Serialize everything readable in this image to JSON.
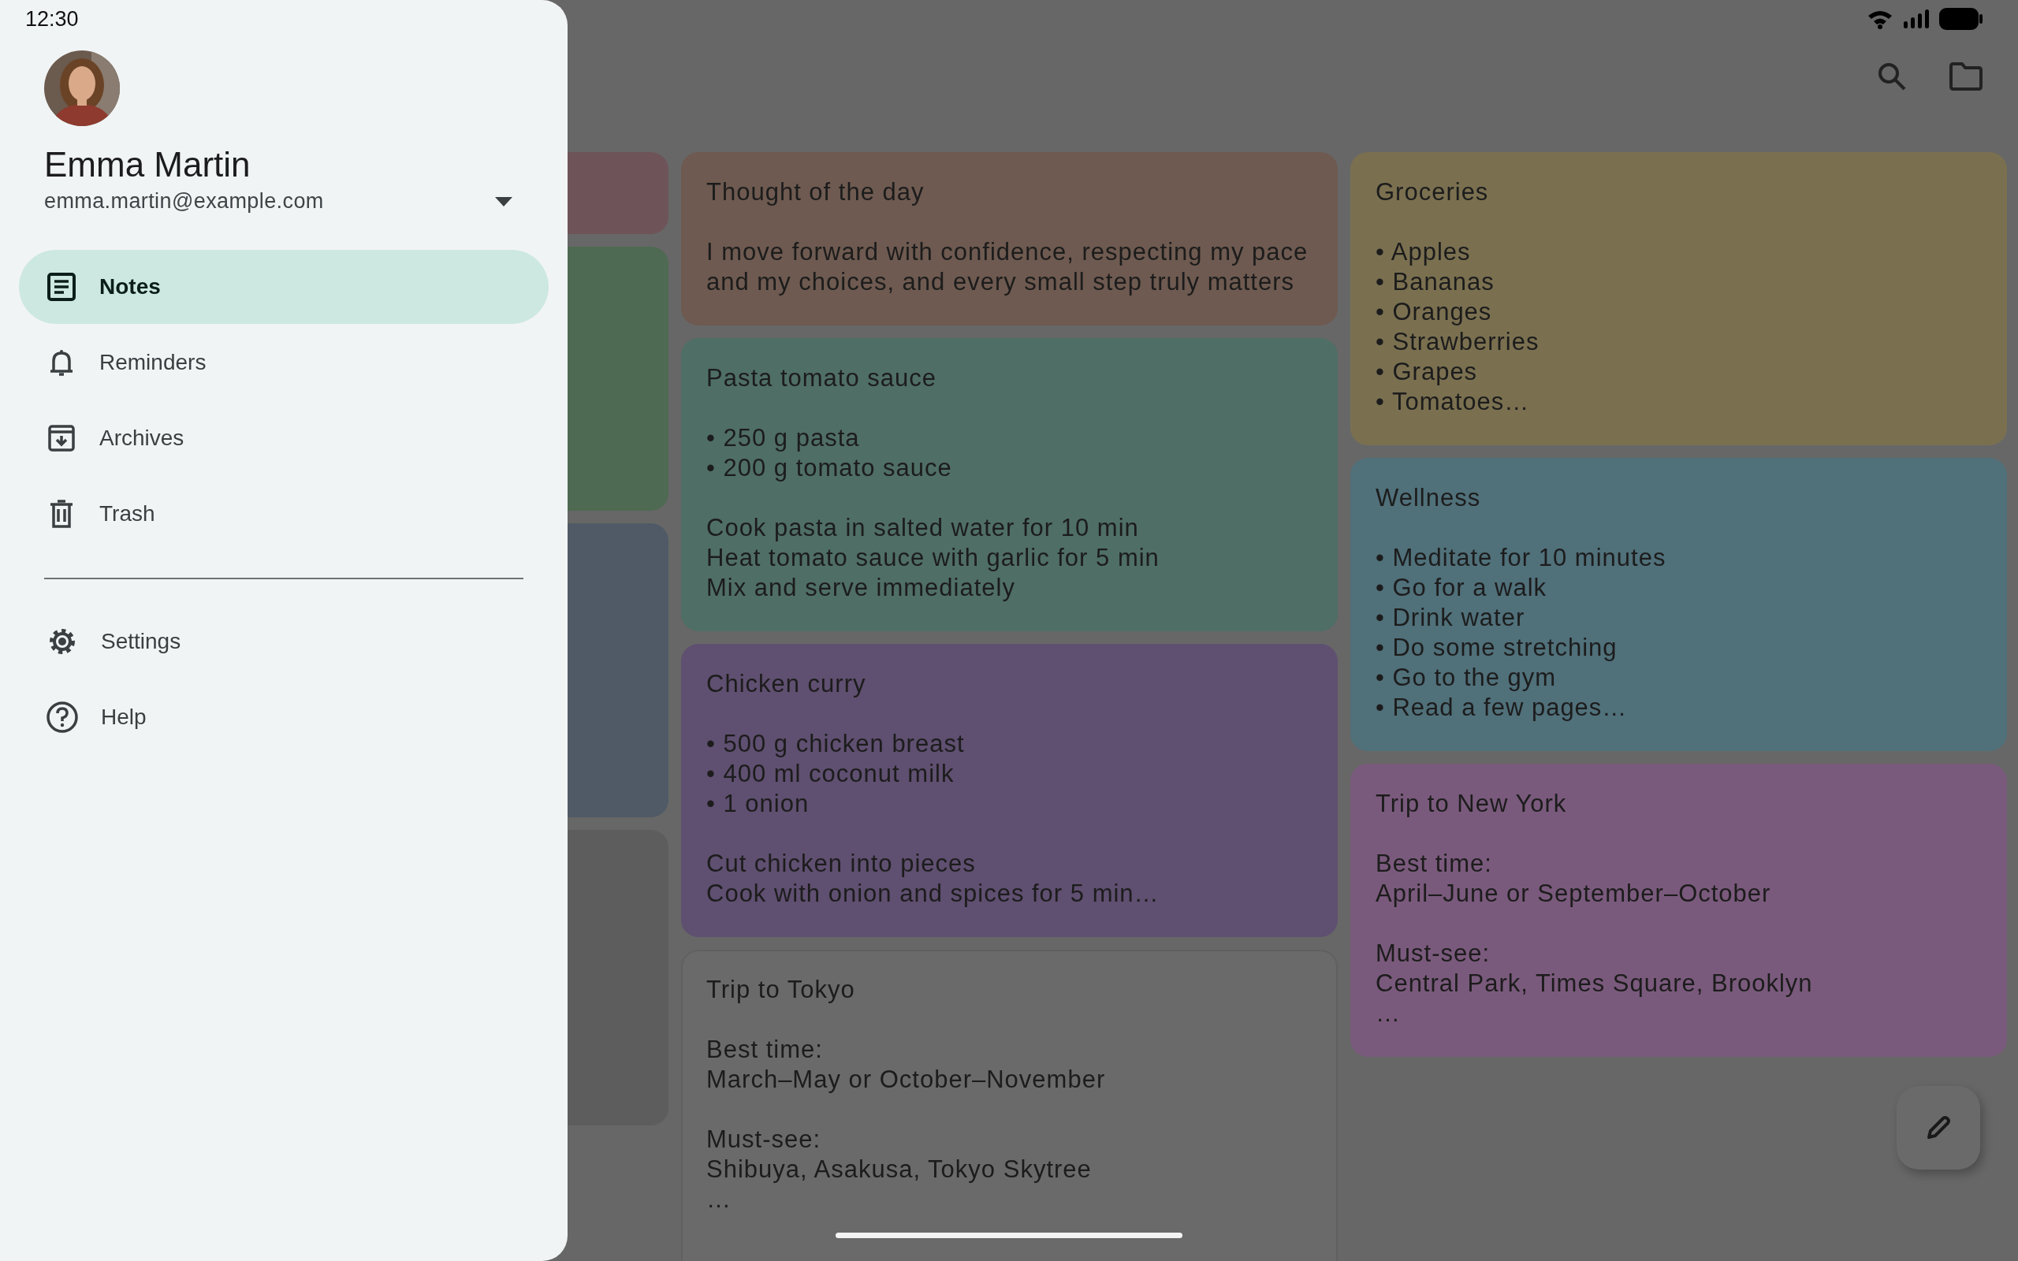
{
  "status_bar": {
    "time": "12:30"
  },
  "drawer": {
    "user": {
      "name": "Emma Martin",
      "email": "emma.martin@example.com"
    },
    "items": [
      {
        "kind": "notes",
        "label": "Notes",
        "selected": true
      },
      {
        "kind": "reminders",
        "label": "Reminders",
        "selected": false
      },
      {
        "kind": "archives",
        "label": "Archives",
        "selected": false
      },
      {
        "kind": "trash",
        "label": "Trash",
        "selected": false
      },
      {
        "kind": "divider"
      },
      {
        "kind": "settings",
        "label": "Settings",
        "selected": false
      },
      {
        "kind": "help",
        "label": "Help",
        "selected": false
      }
    ]
  },
  "columns": [
    {
      "notes": [
        {
          "color": "#6e5458"
        },
        {
          "color": "#4e6a52"
        },
        {
          "color": "#4f5a66"
        },
        {
          "color": "#5d5d5d"
        }
      ]
    },
    {
      "notes": [
        {
          "color": "#6e5a50",
          "title": "Thought of the day",
          "sections": [
            [
              "I move forward with confidence, respecting my pace and my choices, and every small step truly matters"
            ]
          ]
        },
        {
          "color": "#4f6e66",
          "title": "Pasta tomato sauce",
          "sections": [
            [
              "• 250 g pasta",
              "• 200 g tomato sauce"
            ],
            [
              "Cook pasta in salted water for 10 min",
              "Heat tomato sauce with garlic for 5 min",
              "Mix and serve immediately"
            ]
          ]
        },
        {
          "color": "#5f4f70",
          "title": "Chicken curry",
          "sections": [
            [
              "• 500 g chicken breast",
              "• 400 ml coconut milk",
              "• 1 onion"
            ],
            [
              "Cut chicken into pieces",
              "Cook with onion and spices for 5 min…"
            ]
          ]
        },
        {
          "color": "#6a6a6a",
          "title": "Trip to Tokyo",
          "sections": [
            [
              "Best time:",
              "March–May or October–November"
            ],
            [
              "Must-see:",
              "Shibuya, Asakusa, Tokyo Skytree",
              "…"
            ]
          ]
        }
      ]
    },
    {
      "notes": [
        {
          "color": "#7a7050",
          "title": "Groceries",
          "sections": [
            [
              "• Apples",
              "• Bananas",
              "• Oranges",
              "• Strawberries",
              "• Grapes",
              "• Tomatoes…"
            ]
          ]
        },
        {
          "color": "#50707a",
          "title": "Wellness",
          "sections": [
            [
              "• Meditate for 10 minutes",
              "• Go for a walk",
              "• Drink water",
              "• Do some stretching",
              "• Go to the gym",
              "• Read a few pages…"
            ]
          ]
        },
        {
          "color": "#7a5a7c",
          "title": "Trip to New York",
          "sections": [
            [
              "Best time:",
              "April–June or September–October"
            ],
            [
              "Must-see:",
              "Central Park, Times Square, Brooklyn",
              "…"
            ]
          ]
        }
      ]
    }
  ]
}
